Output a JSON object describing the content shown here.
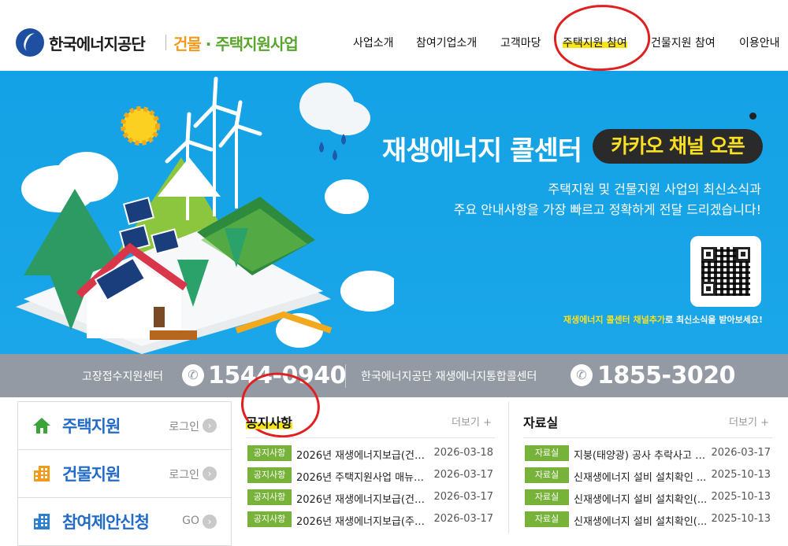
{
  "header": {
    "org_name": "한국에너지공단",
    "service_name_part1": "건물",
    "service_name_dot": "·",
    "service_name_part2": "주택지원사업",
    "nav": [
      {
        "label": "사업소개"
      },
      {
        "label": "참여기업소개"
      },
      {
        "label": "고객마당"
      },
      {
        "label": "주택지원 참여"
      },
      {
        "label": "건물지원 참여"
      },
      {
        "label": "이용안내"
      }
    ]
  },
  "banner": {
    "title": "재생에너지 콜센터",
    "pill": "카카오 채널 오픈",
    "desc_line1": "주택지원 및 건물지원 사업의 최신소식과",
    "desc_line2": "주요 안내사항을 가장 빠르고 정확하게 전달 드리겠습니다!",
    "caption_highlight": "재생에너지 콜센터 채널추가",
    "caption_rest": "로 최신소식을 받아보세요!"
  },
  "callbar": {
    "label1": "고장접수지원센터",
    "number1": "1544-0940",
    "label2": "한국에너지공단 재생에너지통합콜센터",
    "number2": "1855-3020"
  },
  "side": [
    {
      "title": "주택지원",
      "action": "로그인",
      "icon": "home-icon"
    },
    {
      "title": "건물지원",
      "action": "로그인",
      "icon": "building-icon"
    },
    {
      "title": "참여제안신청",
      "action": "GO",
      "icon": "building-icon"
    }
  ],
  "notice": {
    "title": "공지사항",
    "more": "더보기 +",
    "rows": [
      {
        "tag": "공지사항",
        "text": "2026년 재생에너지보급(건물...",
        "date": "2026-03-18"
      },
      {
        "tag": "공지사항",
        "text": "2026년 주택지원사업 매뉴얼...",
        "date": "2026-03-17"
      },
      {
        "tag": "공지사항",
        "text": "2026년 재생에너지보급(건물...",
        "date": "2026-03-17"
      },
      {
        "tag": "공지사항",
        "text": "2026년 재생에너지보급(주택...",
        "date": "2026-03-17"
      }
    ]
  },
  "files": {
    "title": "자료실",
    "more": "더보기 +",
    "rows": [
      {
        "tag": "자료실",
        "text": "지붕(태양광) 공사 추락사고 감...",
        "date": "2026-03-17"
      },
      {
        "tag": "자료실",
        "text": "신재생에너지 설비 설치확인 ...",
        "date": "2025-10-13"
      },
      {
        "tag": "자료실",
        "text": "신재생에너지 설비 설치확인(...",
        "date": "2025-10-13"
      },
      {
        "tag": "자료실",
        "text": "신재생에너지 설비 설치확인(...",
        "date": "2025-10-13"
      }
    ]
  },
  "colors": {
    "banner_bg": "#16a4e7",
    "accent_green": "#77b33a",
    "accent_orange": "#f29a1e",
    "highlight_yellow": "#f5e51a",
    "annotation_red": "#e02020"
  }
}
